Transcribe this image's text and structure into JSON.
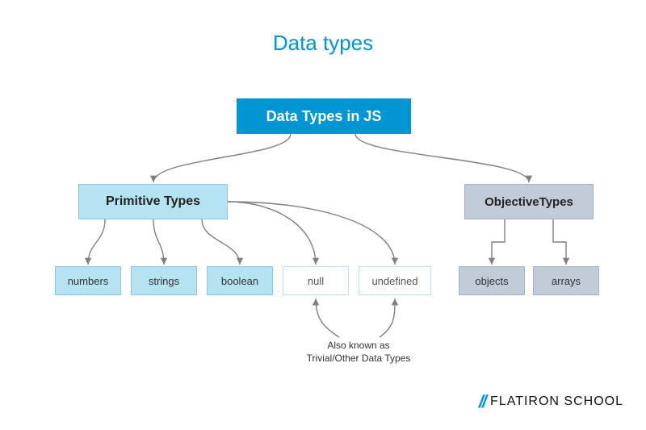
{
  "title": "Data types",
  "root": {
    "label": "Data Types in JS"
  },
  "branches": {
    "primitive": {
      "label": "Primitive Types"
    },
    "objective": {
      "label": "ObjectiveTypes"
    }
  },
  "leaves": {
    "numbers": "numbers",
    "strings": "strings",
    "boolean": "boolean",
    "null": "null",
    "undefined": "undefined",
    "objects": "objects",
    "arrays": "arrays"
  },
  "note": {
    "line1": "Also known as",
    "line2": "Trivial/Other Data Types"
  },
  "brand": {
    "slashes": "//",
    "name": "FLATIRON SCHOOL"
  },
  "colors": {
    "accent": "#0095D3",
    "primitive_fill": "#B6E3F2",
    "objective_fill": "#C2CCD8",
    "arrow": "#808080"
  }
}
